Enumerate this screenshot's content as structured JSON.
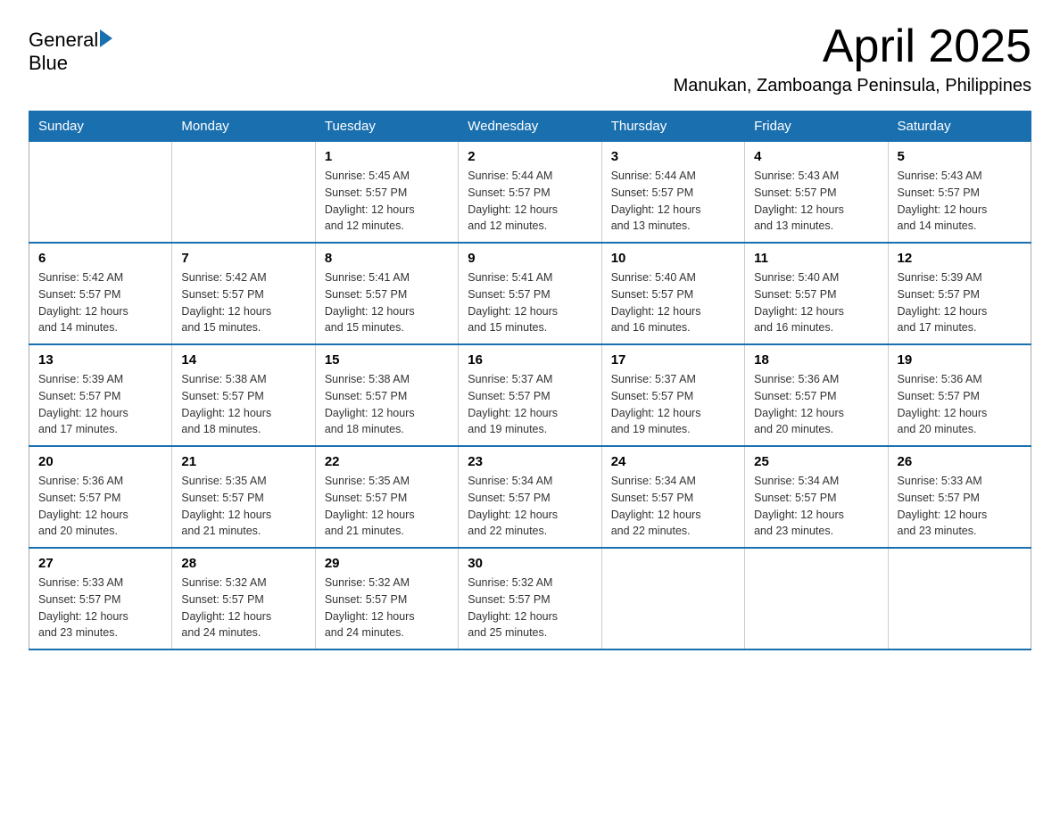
{
  "logo": {
    "text_general": "General",
    "text_blue": "Blue"
  },
  "header": {
    "title": "April 2025",
    "subtitle": "Manukan, Zamboanga Peninsula, Philippines"
  },
  "weekdays": [
    "Sunday",
    "Monday",
    "Tuesday",
    "Wednesday",
    "Thursday",
    "Friday",
    "Saturday"
  ],
  "weeks": [
    [
      {
        "day": "",
        "info": ""
      },
      {
        "day": "",
        "info": ""
      },
      {
        "day": "1",
        "info": "Sunrise: 5:45 AM\nSunset: 5:57 PM\nDaylight: 12 hours\nand 12 minutes."
      },
      {
        "day": "2",
        "info": "Sunrise: 5:44 AM\nSunset: 5:57 PM\nDaylight: 12 hours\nand 12 minutes."
      },
      {
        "day": "3",
        "info": "Sunrise: 5:44 AM\nSunset: 5:57 PM\nDaylight: 12 hours\nand 13 minutes."
      },
      {
        "day": "4",
        "info": "Sunrise: 5:43 AM\nSunset: 5:57 PM\nDaylight: 12 hours\nand 13 minutes."
      },
      {
        "day": "5",
        "info": "Sunrise: 5:43 AM\nSunset: 5:57 PM\nDaylight: 12 hours\nand 14 minutes."
      }
    ],
    [
      {
        "day": "6",
        "info": "Sunrise: 5:42 AM\nSunset: 5:57 PM\nDaylight: 12 hours\nand 14 minutes."
      },
      {
        "day": "7",
        "info": "Sunrise: 5:42 AM\nSunset: 5:57 PM\nDaylight: 12 hours\nand 15 minutes."
      },
      {
        "day": "8",
        "info": "Sunrise: 5:41 AM\nSunset: 5:57 PM\nDaylight: 12 hours\nand 15 minutes."
      },
      {
        "day": "9",
        "info": "Sunrise: 5:41 AM\nSunset: 5:57 PM\nDaylight: 12 hours\nand 15 minutes."
      },
      {
        "day": "10",
        "info": "Sunrise: 5:40 AM\nSunset: 5:57 PM\nDaylight: 12 hours\nand 16 minutes."
      },
      {
        "day": "11",
        "info": "Sunrise: 5:40 AM\nSunset: 5:57 PM\nDaylight: 12 hours\nand 16 minutes."
      },
      {
        "day": "12",
        "info": "Sunrise: 5:39 AM\nSunset: 5:57 PM\nDaylight: 12 hours\nand 17 minutes."
      }
    ],
    [
      {
        "day": "13",
        "info": "Sunrise: 5:39 AM\nSunset: 5:57 PM\nDaylight: 12 hours\nand 17 minutes."
      },
      {
        "day": "14",
        "info": "Sunrise: 5:38 AM\nSunset: 5:57 PM\nDaylight: 12 hours\nand 18 minutes."
      },
      {
        "day": "15",
        "info": "Sunrise: 5:38 AM\nSunset: 5:57 PM\nDaylight: 12 hours\nand 18 minutes."
      },
      {
        "day": "16",
        "info": "Sunrise: 5:37 AM\nSunset: 5:57 PM\nDaylight: 12 hours\nand 19 minutes."
      },
      {
        "day": "17",
        "info": "Sunrise: 5:37 AM\nSunset: 5:57 PM\nDaylight: 12 hours\nand 19 minutes."
      },
      {
        "day": "18",
        "info": "Sunrise: 5:36 AM\nSunset: 5:57 PM\nDaylight: 12 hours\nand 20 minutes."
      },
      {
        "day": "19",
        "info": "Sunrise: 5:36 AM\nSunset: 5:57 PM\nDaylight: 12 hours\nand 20 minutes."
      }
    ],
    [
      {
        "day": "20",
        "info": "Sunrise: 5:36 AM\nSunset: 5:57 PM\nDaylight: 12 hours\nand 20 minutes."
      },
      {
        "day": "21",
        "info": "Sunrise: 5:35 AM\nSunset: 5:57 PM\nDaylight: 12 hours\nand 21 minutes."
      },
      {
        "day": "22",
        "info": "Sunrise: 5:35 AM\nSunset: 5:57 PM\nDaylight: 12 hours\nand 21 minutes."
      },
      {
        "day": "23",
        "info": "Sunrise: 5:34 AM\nSunset: 5:57 PM\nDaylight: 12 hours\nand 22 minutes."
      },
      {
        "day": "24",
        "info": "Sunrise: 5:34 AM\nSunset: 5:57 PM\nDaylight: 12 hours\nand 22 minutes."
      },
      {
        "day": "25",
        "info": "Sunrise: 5:34 AM\nSunset: 5:57 PM\nDaylight: 12 hours\nand 23 minutes."
      },
      {
        "day": "26",
        "info": "Sunrise: 5:33 AM\nSunset: 5:57 PM\nDaylight: 12 hours\nand 23 minutes."
      }
    ],
    [
      {
        "day": "27",
        "info": "Sunrise: 5:33 AM\nSunset: 5:57 PM\nDaylight: 12 hours\nand 23 minutes."
      },
      {
        "day": "28",
        "info": "Sunrise: 5:32 AM\nSunset: 5:57 PM\nDaylight: 12 hours\nand 24 minutes."
      },
      {
        "day": "29",
        "info": "Sunrise: 5:32 AM\nSunset: 5:57 PM\nDaylight: 12 hours\nand 24 minutes."
      },
      {
        "day": "30",
        "info": "Sunrise: 5:32 AM\nSunset: 5:57 PM\nDaylight: 12 hours\nand 25 minutes."
      },
      {
        "day": "",
        "info": ""
      },
      {
        "day": "",
        "info": ""
      },
      {
        "day": "",
        "info": ""
      }
    ]
  ]
}
